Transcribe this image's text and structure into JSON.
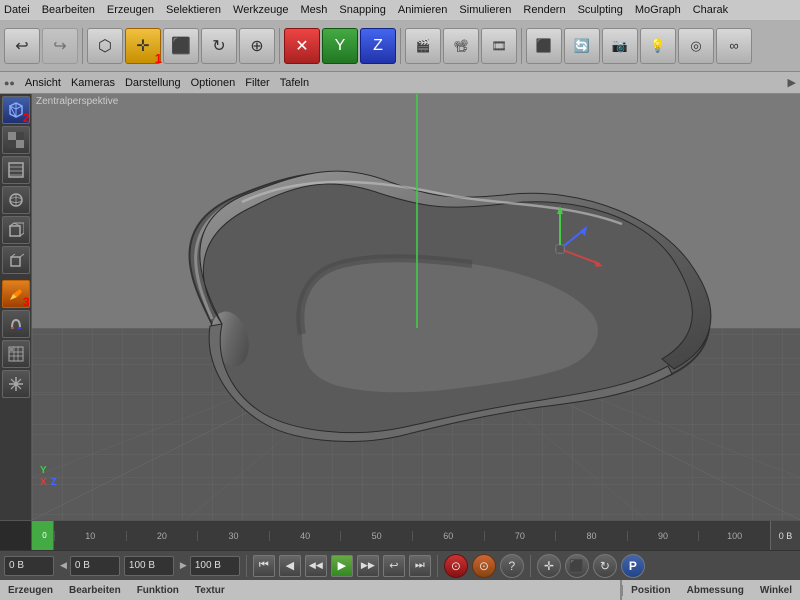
{
  "menubar": {
    "items": [
      "Datei",
      "Bearbeiten",
      "Erzeugen",
      "Selektieren",
      "Werkzeuge",
      "Mesh",
      "Snapping",
      "Animieren",
      "Simulieren",
      "Rendern",
      "Sculpting",
      "MoGraph",
      "Charak"
    ]
  },
  "subtoolbar": {
    "items": [
      "Ansicht",
      "Kameras",
      "Darstellung",
      "Optionen",
      "Filter",
      "Tafeln"
    ]
  },
  "viewport": {
    "label": "Zentralperspektive"
  },
  "timeline": {
    "ticks": [
      "0",
      "10",
      "20",
      "30",
      "40",
      "50",
      "60",
      "70",
      "80",
      "90",
      "100"
    ],
    "right_label": "0 B"
  },
  "transport": {
    "field1": "0 B",
    "field2": "0 B",
    "field3": "100 B",
    "field4": "100 B"
  },
  "bottombar": {
    "left_items": [
      "Erzeugen",
      "Bearbeiten",
      "Funktion",
      "Textur"
    ],
    "right_items": [
      "Position",
      "Abmessung",
      "Winkel"
    ]
  },
  "numbers": {
    "n1": "1",
    "n2": "2",
    "n3": "3"
  }
}
